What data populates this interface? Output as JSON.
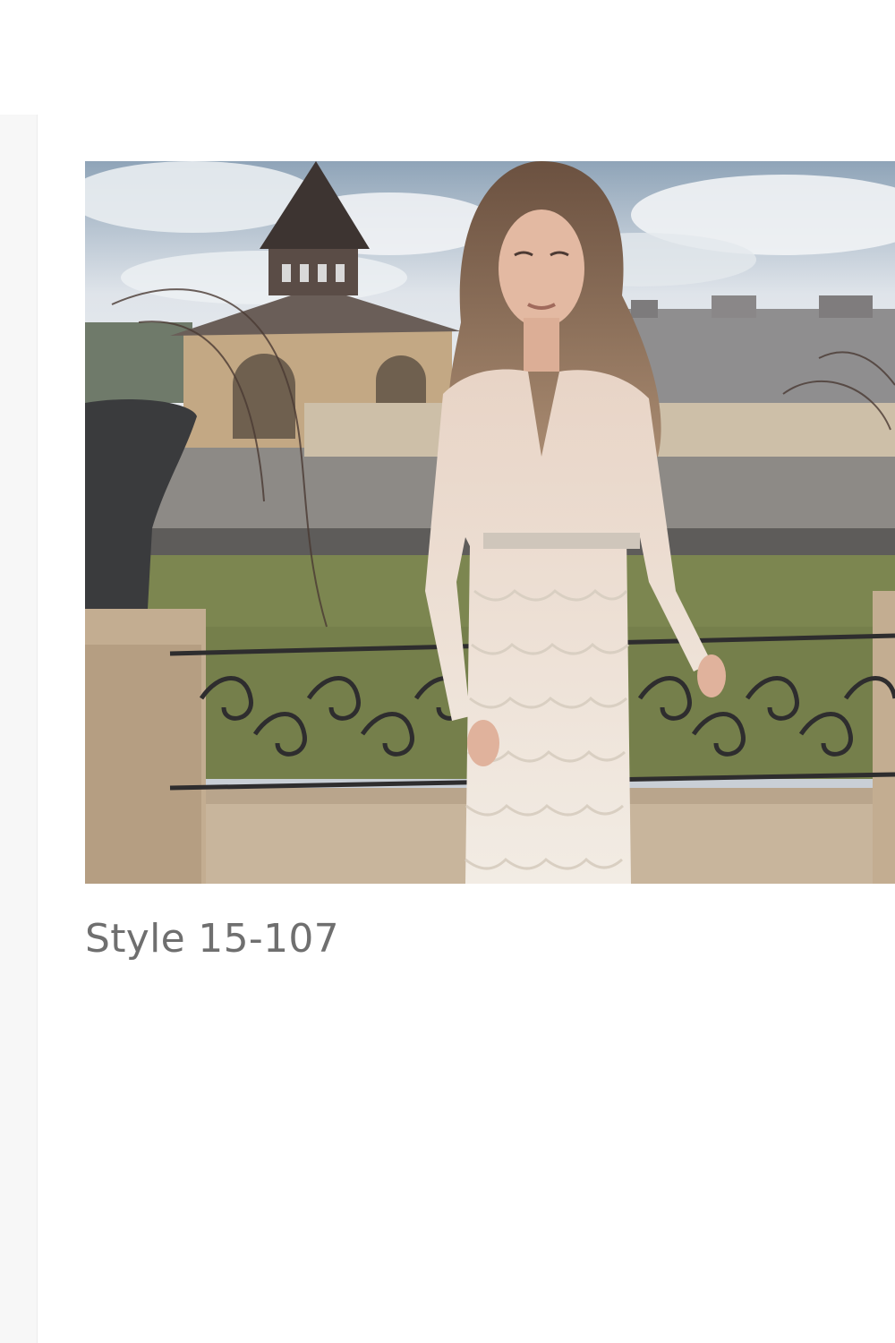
{
  "product": {
    "title": "Style 15-107"
  }
}
